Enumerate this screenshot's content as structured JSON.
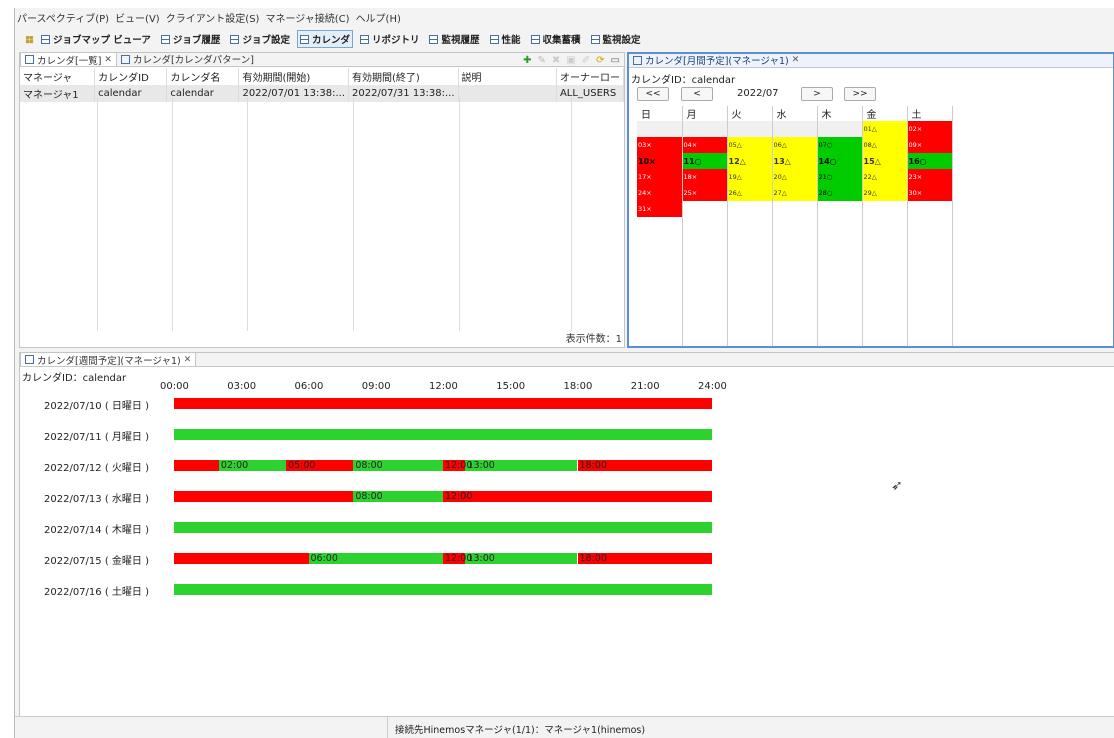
{
  "menu": [
    "パースペクティブ(P)",
    "ビュー(V)",
    "クライアント設定(S)",
    "マネージャ接続(C)",
    "ヘルプ(H)"
  ],
  "toolbar": [
    "ジョブマップ ビューア",
    "ジョブ履歴",
    "ジョブ設定",
    "カレンダ",
    "リポジトリ",
    "監視履歴",
    "性能",
    "収集蓄積",
    "監視設定"
  ],
  "left_tabs": [
    "カレンダ[一覧]",
    "カレンダ[カレンダパターン]"
  ],
  "list": {
    "headers": [
      "マネージャ",
      "カレンダID",
      "カレンダ名",
      "有効期間(開始)",
      "有効期間(終了)",
      "説明",
      "オーナーロー"
    ],
    "rows": [
      [
        "マネージャ1",
        "calendar",
        "calendar",
        "2022/07/01 13:38:...",
        "2022/07/31 13:38:...",
        "",
        "ALL_USERS"
      ]
    ],
    "count": "表示件数：1"
  },
  "month": {
    "tab": "カレンダ[月間予定](マネージャ1)",
    "calid": "カレンダID：calendar",
    "nav": [
      "<<",
      "<",
      ">",
      ">>"
    ],
    "ym": "2022/07",
    "weekdays": [
      "日",
      "月",
      "火",
      "水",
      "木",
      "金",
      "土"
    ],
    "weeks": [
      [
        [
          "",
          ""
        ],
        [
          "",
          ""
        ],
        [
          "",
          ""
        ],
        [
          "",
          ""
        ],
        [
          "",
          ""
        ],
        [
          "01△",
          "y"
        ],
        [
          "02×",
          "r"
        ]
      ],
      [
        [
          "03×",
          "r"
        ],
        [
          "04×",
          "r"
        ],
        [
          "05△",
          "y"
        ],
        [
          "06△",
          "y"
        ],
        [
          "07○",
          "g"
        ],
        [
          "08△",
          "y"
        ],
        [
          "09×",
          "r"
        ]
      ],
      [
        [
          "10×",
          "r"
        ],
        [
          "11○",
          "g"
        ],
        [
          "12△",
          "y"
        ],
        [
          "13△",
          "y"
        ],
        [
          "14○",
          "g"
        ],
        [
          "15△",
          "y"
        ],
        [
          "16○",
          "g"
        ]
      ],
      [
        [
          "17×",
          "r"
        ],
        [
          "18×",
          "r"
        ],
        [
          "19△",
          "y"
        ],
        [
          "20△",
          "y"
        ],
        [
          "21○",
          "g"
        ],
        [
          "22△",
          "y"
        ],
        [
          "23×",
          "r"
        ]
      ],
      [
        [
          "24×",
          "r"
        ],
        [
          "25×",
          "r"
        ],
        [
          "26△",
          "y"
        ],
        [
          "27△",
          "y"
        ],
        [
          "28○",
          "g"
        ],
        [
          "29△",
          "y"
        ],
        [
          "30×",
          "r"
        ]
      ],
      [
        [
          "31×",
          "r"
        ],
        [
          "",
          ""
        ],
        [
          "",
          ""
        ],
        [
          "",
          ""
        ],
        [
          "",
          ""
        ],
        [
          "",
          ""
        ],
        [
          "",
          ""
        ]
      ]
    ]
  },
  "week": {
    "tab": "カレンダ[週間予定](マネージャ1)",
    "calid": "カレンダID：calendar",
    "hours": [
      "00:00",
      "03:00",
      "06:00",
      "09:00",
      "12:00",
      "15:00",
      "18:00",
      "21:00",
      "24:00"
    ],
    "days": [
      {
        "label": "2022/07/10 ( 日曜日 )",
        "segments": [
          {
            "from": 0,
            "to": 24,
            "c": "r"
          }
        ],
        "labels": []
      },
      {
        "label": "2022/07/11 ( 月曜日 )",
        "segments": [
          {
            "from": 0,
            "to": 24,
            "c": "g"
          }
        ],
        "labels": []
      },
      {
        "label": "2022/07/12 ( 火曜日 )",
        "segments": [
          {
            "from": 0,
            "to": 2,
            "c": "r"
          },
          {
            "from": 2,
            "to": 5,
            "c": "g"
          },
          {
            "from": 5,
            "to": 8,
            "c": "r"
          },
          {
            "from": 8,
            "to": 12,
            "c": "g"
          },
          {
            "from": 12,
            "to": 13,
            "c": "r"
          },
          {
            "from": 13,
            "to": 18,
            "c": "g"
          },
          {
            "from": 18,
            "to": 24,
            "c": "r"
          }
        ],
        "labels": [
          [
            "02:00",
            2
          ],
          [
            "05:00",
            5
          ],
          [
            "08:00",
            8
          ],
          [
            "12:00",
            12
          ],
          [
            "13:00",
            13
          ],
          [
            "18:00",
            18
          ]
        ]
      },
      {
        "label": "2022/07/13 ( 水曜日 )",
        "segments": [
          {
            "from": 0,
            "to": 8,
            "c": "r"
          },
          {
            "from": 8,
            "to": 12,
            "c": "g"
          },
          {
            "from": 12,
            "to": 24,
            "c": "r"
          }
        ],
        "labels": [
          [
            "08:00",
            8
          ],
          [
            "12:00",
            12
          ]
        ]
      },
      {
        "label": "2022/07/14 ( 木曜日 )",
        "segments": [
          {
            "from": 0,
            "to": 24,
            "c": "g"
          }
        ],
        "labels": []
      },
      {
        "label": "2022/07/15 ( 金曜日 )",
        "segments": [
          {
            "from": 0,
            "to": 6,
            "c": "r"
          },
          {
            "from": 6,
            "to": 12,
            "c": "g"
          },
          {
            "from": 12,
            "to": 13,
            "c": "r"
          },
          {
            "from": 13,
            "to": 18,
            "c": "g"
          },
          {
            "from": 18,
            "to": 24,
            "c": "r"
          }
        ],
        "labels": [
          [
            "06:00",
            6
          ],
          [
            "12:00",
            12
          ],
          [
            "13:00",
            13
          ],
          [
            "18:00",
            18
          ]
        ]
      },
      {
        "label": "2022/07/16 ( 土曜日 )",
        "segments": [
          {
            "from": 0,
            "to": 24,
            "c": "g"
          }
        ],
        "labels": []
      }
    ]
  },
  "status": "接続先Hinemosマネージャ(1/1)：マネージャ1(hinemos)"
}
